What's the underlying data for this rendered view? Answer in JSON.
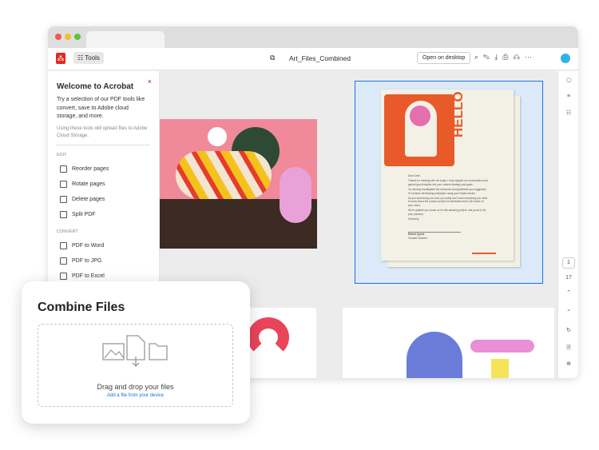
{
  "window": {
    "document_title": "Art_Files_Combined",
    "tools_label": "Tools",
    "open_desktop_label": "Open on desktop"
  },
  "panel": {
    "title": "Welcome to Acrobat",
    "intro": "Try a selection of our PDF tools like convert, save to Adobe cloud storage, and more.",
    "note": "Using these tools will upload files to Adobe Cloud Storage.",
    "sections": [
      {
        "label": "EDIT",
        "items": [
          "Reorder pages",
          "Rotate pages",
          "Delete pages",
          "Split PDF"
        ]
      },
      {
        "label": "CONVERT",
        "items": [
          "PDF to Word",
          "PDF to JPG",
          "PDF to Excel"
        ]
      }
    ]
  },
  "letter": {
    "hello": "HELLO",
    "greeting": "Dear Jane,",
    "paragraphs": [
      "Thanks for meeting with me today. I truly enjoyed our conversation and gained good insights into your content strategy and goals.",
      "I've already investigated the resources and guidelines you suggested. I'll continue developing prototypes using your helpful advice.",
      "As you said during our chat, you really can't learn everything you need to know about the product unless it's fabricated and in the hands of your users.",
      "We're grateful you chose us for this amazing project, and proud to be your partners."
    ],
    "closing": "Sincerely,",
    "name": "Robert Quest",
    "role": "Creative Director"
  },
  "rail": {
    "page_current": "1",
    "page_total": "17"
  },
  "combine": {
    "title": "Combine Files",
    "drop_text": "Drag and drop your files",
    "link": "Add a file from your device"
  },
  "colors": {
    "accent": "#1473e6",
    "acrobat_red": "#e4281b",
    "selection": "#dbe9f9"
  }
}
